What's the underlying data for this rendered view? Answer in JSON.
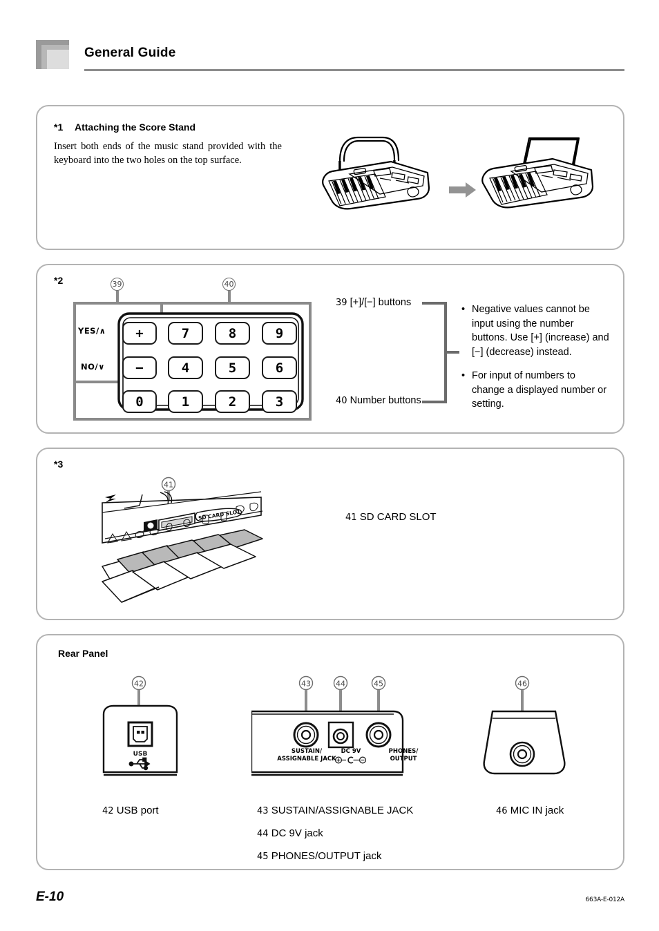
{
  "header": {
    "title": "General Guide"
  },
  "footer": {
    "page": "E-10",
    "code": "663A-E-012A"
  },
  "section1": {
    "marker": "*1",
    "heading": "Attaching the Score Stand",
    "body": "Insert both ends of the music stand provided with the keyboard into the two holes on the top surface.",
    "figure_left": "keyboard-with-stand-inserting-illustration",
    "figure_arrow": "right-arrow-icon",
    "figure_right": "keyboard-with-stand-attached-illustration"
  },
  "section2": {
    "marker": "*2",
    "numberpad": {
      "callout_plus_minus": "39",
      "callout_numbers": "40",
      "yes_label": "YES/∧",
      "no_label": "NO/∨",
      "plus_key": "+",
      "minus_key": "−",
      "rows": [
        [
          "7",
          "8",
          "9"
        ],
        [
          "4",
          "5",
          "6"
        ]
      ],
      "bottom_row": [
        "0",
        "1",
        "2",
        "3"
      ]
    },
    "labels": [
      {
        "num": "39",
        "text": "[+]/[−] buttons"
      },
      {
        "num": "40",
        "text": "Number buttons"
      }
    ],
    "bullets": [
      "Negative values cannot be input using the number buttons. Use [+] (increase) and [−] (decrease) instead.",
      "For input of numbers to change a displayed number or setting."
    ]
  },
  "section3": {
    "marker": "*3",
    "callout_number": "41",
    "slot_panel_label": "SD CARD SLOT",
    "label": {
      "num": "41",
      "text": "SD CARD SLOT"
    },
    "figure": "sd-card-slot-closeup-illustration"
  },
  "section4": {
    "heading": "Rear Panel",
    "usb": {
      "callout_number": "42",
      "port_label": "USB",
      "port_symbol": "usb-trident-icon"
    },
    "jacks": {
      "sustain": {
        "callout_number": "43",
        "label_line1": "SUSTAIN/",
        "label_line2": "ASSIGNABLE JACK"
      },
      "dc9v": {
        "callout_number": "44",
        "label_line1": "DC 9V",
        "polarity_symbol": "center-negative-polarity-icon"
      },
      "phones": {
        "callout_number": "45",
        "label_line1": "PHONES/",
        "label_line2": "OUTPUT"
      }
    },
    "mic": {
      "callout_number": "46"
    },
    "legend_col1": [
      {
        "num": "42",
        "text": "USB port"
      }
    ],
    "legend_col2": [
      {
        "num": "43",
        "text": "SUSTAIN/ASSIGNABLE JACK"
      },
      {
        "num": "44",
        "text": "DC 9V jack"
      },
      {
        "num": "45",
        "text": "PHONES/OUTPUT jack"
      }
    ],
    "legend_col3": [
      {
        "num": "46",
        "text": "MIC IN jack"
      }
    ]
  },
  "colors": {
    "panel_border": "#b3b3b3",
    "rule": "#8c8c8c",
    "callout_line": "#8a8a8a",
    "ink": "#000000"
  }
}
